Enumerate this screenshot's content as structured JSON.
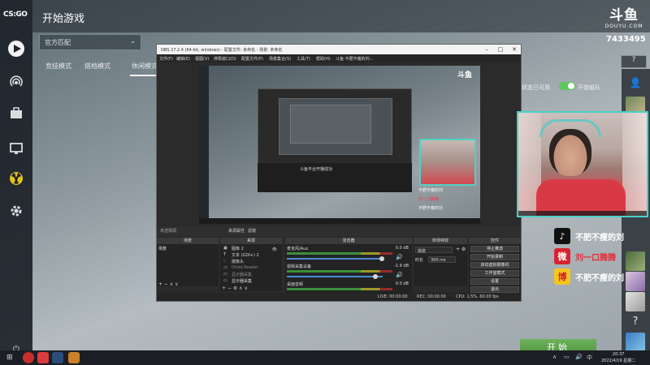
{
  "game": {
    "logo": "CS:GO",
    "title": "开始游戏",
    "mode_select": "官方匹配",
    "tabs": [
      "竞技模式",
      "搭档模式",
      "休闲模式"
    ],
    "status_toggle_label": "状态已可用",
    "friends_toggle_label": "开始组队",
    "start_button": "开始"
  },
  "douyu": {
    "brand": "斗鱼",
    "brand_sub": "DOUYU.COM",
    "room_number": "7433495",
    "help": "?"
  },
  "obs": {
    "title": "OBS 27.2.4 (64-bit, windows) - 配置文件: 未命名 - 场景: 未命名",
    "menu": [
      "文件(F)",
      "编辑(E)",
      "视图(V)",
      "停靠窗口(D)",
      "配置文件(P)",
      "场景集合(S)",
      "工具(T)",
      "帮助(H)",
      "斗鱼·不肥不瘦的刘..."
    ],
    "dock_tabs": [
      "来源属性",
      "滤镜"
    ],
    "dock_headers": [
      "场景",
      "来源",
      "混音器",
      "转场特效",
      "控件"
    ],
    "scenes": [
      "场景"
    ],
    "sources": [
      "图像 2",
      "文本 (GDI+) 2",
      "摄像头",
      "Droid Reader",
      "显示器采集",
      "显示器采集"
    ],
    "mixer": [
      {
        "name": "麦克风/Aux",
        "db": "0.0 dB"
      },
      {
        "name": "视频采集设备",
        "db": "-1.9 dB"
      },
      {
        "name": "桌面音频",
        "db": "0.0 dB"
      }
    ],
    "transitions": {
      "type": "渐变",
      "duration_label": "时长",
      "duration": "300 ms"
    },
    "controls": [
      "停止推流",
      "开始录制",
      "启动虚拟摄像机",
      "工作室模式",
      "设置",
      "退出"
    ],
    "status": {
      "live": "LIVE: 00:00:00",
      "rec": "REC: 00:00:00",
      "cpu": "CPU: 1.5%, 60.00 fps"
    }
  },
  "preview": {
    "douyu": "斗鱼",
    "streaming_text": "斗鱼平台开播成功",
    "socials": [
      "不肥不瘦的刘",
      "刘一口腾腾",
      "不肥不瘦的刘"
    ]
  },
  "socials": [
    {
      "icon": "tiktok-icon",
      "symbol": "♪",
      "text": "不肥不瘦的刘",
      "bg": "#111111",
      "color": "#ffffff",
      "text_color": "#ffffff"
    },
    {
      "icon": "weibo-icon",
      "symbol": "微",
      "text": "刘一口腾腾",
      "bg": "#d7232f",
      "color": "#ffffff",
      "text_color": "#e0303a"
    },
    {
      "icon": "weibo-icon",
      "symbol": "博",
      "text": "不肥不瘦的刘",
      "bg": "#f4c51f",
      "color": "#d7232f",
      "text_color": "#ffffff"
    }
  ],
  "taskbar": {
    "time": "20:37",
    "date": "2022/4/19 星期二"
  },
  "colors": {
    "accent_green": "#5cc85a",
    "webcam_border": "#49d1c7"
  }
}
